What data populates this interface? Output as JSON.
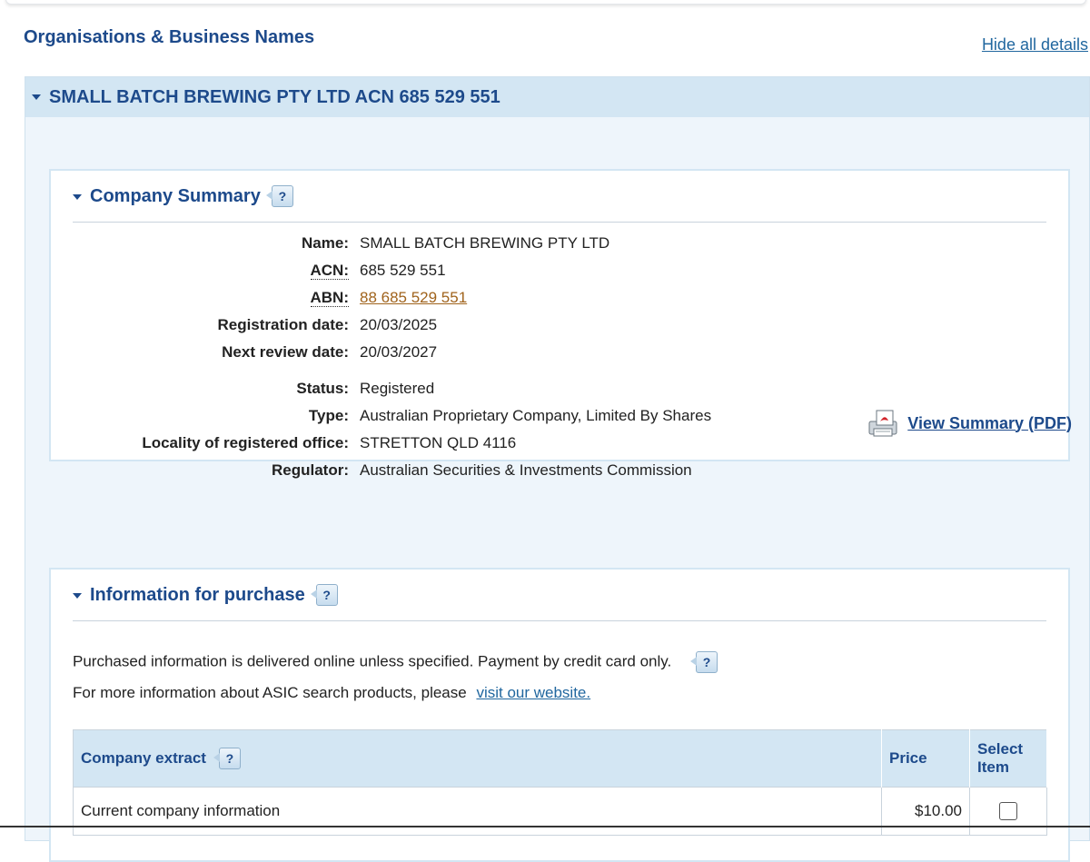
{
  "page": {
    "heading": "Organisations & Business Names",
    "hide_details": "Hide all details"
  },
  "entity": {
    "title": "SMALL BATCH BREWING PTY LTD ACN 685 529 551"
  },
  "summary": {
    "title": "Company Summary",
    "help": "?",
    "rows": [
      {
        "label": "Name:",
        "value": "SMALL BATCH BREWING PTY LTD"
      },
      {
        "label": "ACN:",
        "value": "685 529 551"
      },
      {
        "label": "ABN:",
        "value": "88 685 529 551"
      },
      {
        "label": "Registration date:",
        "value": "20/03/2025"
      },
      {
        "label": "Next review date:",
        "value": "20/03/2027"
      },
      {
        "label": "Status:",
        "value": "Registered"
      },
      {
        "label": "Type:",
        "value": "Australian Proprietary Company, Limited By Shares"
      },
      {
        "label": "Locality of registered office:",
        "value": "STRETTON QLD 4116"
      },
      {
        "label": "Regulator:",
        "value": "Australian Securities & Investments Commission"
      }
    ],
    "pdf_link": "View Summary (PDF)"
  },
  "purchase": {
    "title": "Information for purchase",
    "help": "?",
    "line1": "Purchased information is delivered online unless specified. Payment by credit card only.",
    "line2": "For more information about ASIC search products, please",
    "link": "visit our website.",
    "table": {
      "col_extract": "Company extract",
      "col_price": "Price",
      "col_select": "Select Item",
      "rows": [
        {
          "name": "Current company information",
          "price": "$10.00",
          "selected": false
        }
      ]
    }
  },
  "icons": {
    "help": "help-question-icon",
    "pdf": "pdf-printer-icon",
    "caret": "caret-down-icon"
  },
  "colors": {
    "heading_blue": "#1d4a8b",
    "link_blue": "#21679f",
    "abn_link": "#a0631c",
    "panel_bg": "#eef5fb",
    "header_bg": "#d3e6f3"
  }
}
